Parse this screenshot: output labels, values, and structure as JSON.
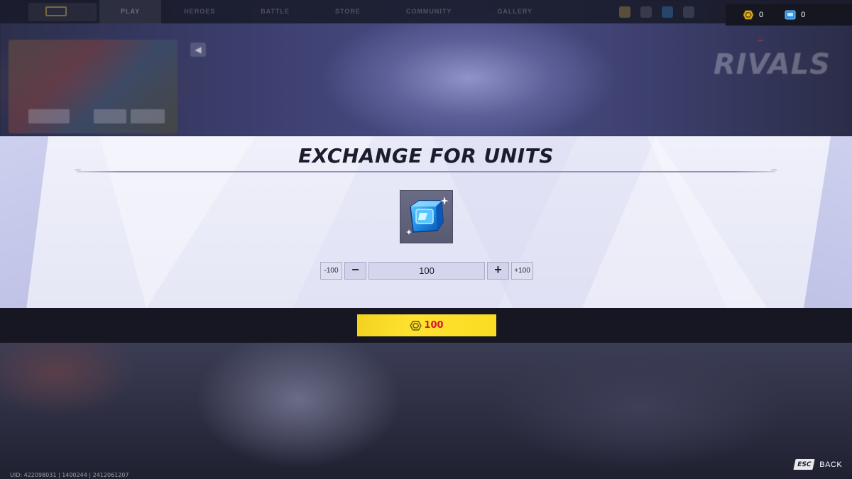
{
  "topbar": {
    "tabs": [
      "PLAY",
      "HEROES",
      "BATTLE",
      "STORE",
      "COMMUNITY",
      "GALLERY"
    ],
    "currency_units_gold": "0",
    "currency_units_blue": "0"
  },
  "background": {
    "logo_text": "RIVALS"
  },
  "panel": {
    "title": "EXCHANGE FOR UNITS",
    "decrement_large_label": "-100",
    "decrement_label": "−",
    "quantity_value": "100",
    "increment_label": "+",
    "increment_large_label": "+100"
  },
  "confirm": {
    "cost": "100"
  },
  "footer": {
    "uid_text": "UID: 422098031 | 1400244 | 2412061207",
    "esc_key": "ESC",
    "back_label": "BACK"
  },
  "colors": {
    "accent_yellow": "#ffe230",
    "cost_red": "#d8142a",
    "unit_blue": "#2f8fe0",
    "lattice_gold": "#e8b820"
  },
  "icons": {
    "gold_currency": "lattice-currency-icon",
    "blue_currency": "units-currency-icon",
    "item": "units-crystal-icon"
  }
}
